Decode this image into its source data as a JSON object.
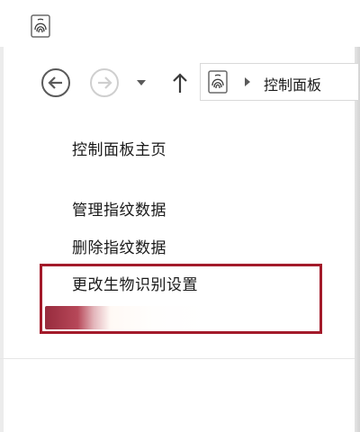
{
  "window": {
    "title_icon": "fingerprint-icon"
  },
  "navigation": {
    "back_icon": "back-arrow-icon",
    "forward_icon": "forward-arrow-icon",
    "recent_icon": "chevron-down-icon",
    "up_icon": "up-arrow-icon",
    "address": {
      "icon": "fingerprint-icon",
      "separator_icon": "chevron-right-icon",
      "location": "控制面板"
    }
  },
  "sidebar": {
    "home_link": "控制面板主页",
    "links": [
      "管理指纹数据",
      "删除指纹数据",
      "更改生物识别设置"
    ]
  },
  "colors": {
    "highlight": "#a31a2a",
    "text": "#1a1a1a",
    "nav_active": "#5a5a5a",
    "nav_disabled": "#cfcfcf"
  }
}
